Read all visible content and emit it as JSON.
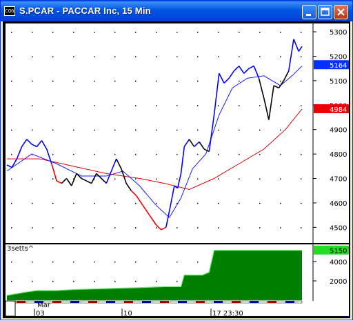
{
  "window": {
    "title": "S.PCAR - PACCAR Inc, 15 Min",
    "icon_text": "CQG",
    "buttons": [
      "minimize-icon",
      "maximize-icon",
      "close-icon"
    ]
  },
  "colors": {
    "up": "#0000ff",
    "down": "#ee0000",
    "neutral": "#000000",
    "ma_short": "#1a1aff",
    "ma_long": "#dd0000",
    "volume": "#008000",
    "volume_line": "#5fe85f",
    "label_blue": "#0033ff",
    "label_red": "#ee0000",
    "label_green": "#22dd22"
  },
  "chart_data": [
    {
      "type": "line",
      "title": "S.PCAR - PACCAR Inc, 15 Min",
      "price_axis": {
        "ticks": [
          "5300",
          "5200",
          "5100",
          "5000",
          "4900",
          "4800",
          "4700",
          "4600",
          "4500"
        ],
        "ylim": [
          4450,
          5320
        ]
      },
      "time_axis": {
        "labels": [
          "Mar",
          "03",
          "10",
          "17 23:30"
        ]
      },
      "markers": [
        {
          "label": "5164",
          "value": 5164,
          "color": "blue"
        },
        {
          "label": "4984",
          "value": 4984,
          "color": "red"
        }
      ],
      "price_series": [
        {
          "x": 0,
          "y": 4755
        },
        {
          "x": 3,
          "y": 4745
        },
        {
          "x": 6,
          "y": 4780
        },
        {
          "x": 9,
          "y": 4830
        },
        {
          "x": 12,
          "y": 4860
        },
        {
          "x": 15,
          "y": 4840
        },
        {
          "x": 18,
          "y": 4830
        },
        {
          "x": 21,
          "y": 4855
        },
        {
          "x": 24,
          "y": 4820
        },
        {
          "x": 27,
          "y": 4760
        },
        {
          "x": 30,
          "y": 4690
        },
        {
          "x": 33,
          "y": 4680
        },
        {
          "x": 36,
          "y": 4700
        },
        {
          "x": 39,
          "y": 4670
        },
        {
          "x": 42,
          "y": 4720
        },
        {
          "x": 45,
          "y": 4700
        },
        {
          "x": 48,
          "y": 4690
        },
        {
          "x": 51,
          "y": 4680
        },
        {
          "x": 54,
          "y": 4720
        },
        {
          "x": 57,
          "y": 4700
        },
        {
          "x": 60,
          "y": 4680
        },
        {
          "x": 63,
          "y": 4730
        },
        {
          "x": 66,
          "y": 4780
        },
        {
          "x": 69,
          "y": 4740
        },
        {
          "x": 72,
          "y": 4680
        },
        {
          "x": 75,
          "y": 4650
        },
        {
          "x": 78,
          "y": 4630
        },
        {
          "x": 81,
          "y": 4600
        },
        {
          "x": 84,
          "y": 4570
        },
        {
          "x": 87,
          "y": 4540
        },
        {
          "x": 90,
          "y": 4510
        },
        {
          "x": 93,
          "y": 4490
        },
        {
          "x": 96,
          "y": 4500
        },
        {
          "x": 99,
          "y": 4600
        },
        {
          "x": 101,
          "y": 4670
        },
        {
          "x": 103,
          "y": 4660
        },
        {
          "x": 105,
          "y": 4720
        },
        {
          "x": 107,
          "y": 4830
        },
        {
          "x": 110,
          "y": 4860
        },
        {
          "x": 113,
          "y": 4830
        },
        {
          "x": 116,
          "y": 4850
        },
        {
          "x": 119,
          "y": 4820
        },
        {
          "x": 122,
          "y": 4810
        },
        {
          "x": 125,
          "y": 4960
        },
        {
          "x": 128,
          "y": 5130
        },
        {
          "x": 131,
          "y": 5090
        },
        {
          "x": 134,
          "y": 5110
        },
        {
          "x": 137,
          "y": 5140
        },
        {
          "x": 140,
          "y": 5160
        },
        {
          "x": 143,
          "y": 5130
        },
        {
          "x": 146,
          "y": 5150
        },
        {
          "x": 149,
          "y": 5160
        },
        {
          "x": 152,
          "y": 5110
        },
        {
          "x": 155,
          "y": 5030
        },
        {
          "x": 158,
          "y": 4940
        },
        {
          "x": 161,
          "y": 5080
        },
        {
          "x": 164,
          "y": 5070
        },
        {
          "x": 167,
          "y": 5100
        },
        {
          "x": 170,
          "y": 5140
        },
        {
          "x": 173,
          "y": 5270
        },
        {
          "x": 176,
          "y": 5220
        },
        {
          "x": 178,
          "y": 5240
        }
      ],
      "ma_short": [
        {
          "x": 0,
          "y": 4730
        },
        {
          "x": 15,
          "y": 4800
        },
        {
          "x": 30,
          "y": 4760
        },
        {
          "x": 45,
          "y": 4710
        },
        {
          "x": 60,
          "y": 4710
        },
        {
          "x": 70,
          "y": 4730
        },
        {
          "x": 80,
          "y": 4670
        },
        {
          "x": 90,
          "y": 4590
        },
        {
          "x": 98,
          "y": 4540
        },
        {
          "x": 105,
          "y": 4620
        },
        {
          "x": 112,
          "y": 4740
        },
        {
          "x": 120,
          "y": 4800
        },
        {
          "x": 128,
          "y": 4960
        },
        {
          "x": 136,
          "y": 5070
        },
        {
          "x": 145,
          "y": 5110
        },
        {
          "x": 155,
          "y": 5120
        },
        {
          "x": 165,
          "y": 5080
        },
        {
          "x": 172,
          "y": 5120
        },
        {
          "x": 178,
          "y": 5160
        }
      ],
      "ma_long": [
        {
          "x": 0,
          "y": 4780
        },
        {
          "x": 20,
          "y": 4780
        },
        {
          "x": 40,
          "y": 4750
        },
        {
          "x": 60,
          "y": 4720
        },
        {
          "x": 80,
          "y": 4700
        },
        {
          "x": 95,
          "y": 4680
        },
        {
          "x": 110,
          "y": 4655
        },
        {
          "x": 125,
          "y": 4700
        },
        {
          "x": 140,
          "y": 4760
        },
        {
          "x": 155,
          "y": 4820
        },
        {
          "x": 168,
          "y": 4900
        },
        {
          "x": 178,
          "y": 4984
        }
      ]
    },
    {
      "type": "area",
      "title": "3setts^",
      "ticks": [
        "4000",
        "2000"
      ],
      "ylim": [
        0,
        5200
      ],
      "marker": {
        "label": "5150",
        "value": 5150
      },
      "values": [
        {
          "x": 0,
          "y": 500
        },
        {
          "x": 10,
          "y": 800
        },
        {
          "x": 18,
          "y": 1000
        },
        {
          "x": 30,
          "y": 1000
        },
        {
          "x": 40,
          "y": 1100
        },
        {
          "x": 60,
          "y": 1200
        },
        {
          "x": 80,
          "y": 1300
        },
        {
          "x": 95,
          "y": 1400
        },
        {
          "x": 105,
          "y": 1400
        },
        {
          "x": 107,
          "y": 2600
        },
        {
          "x": 118,
          "y": 2600
        },
        {
          "x": 122,
          "y": 2900
        },
        {
          "x": 125,
          "y": 5150
        },
        {
          "x": 178,
          "y": 5150
        }
      ]
    }
  ]
}
